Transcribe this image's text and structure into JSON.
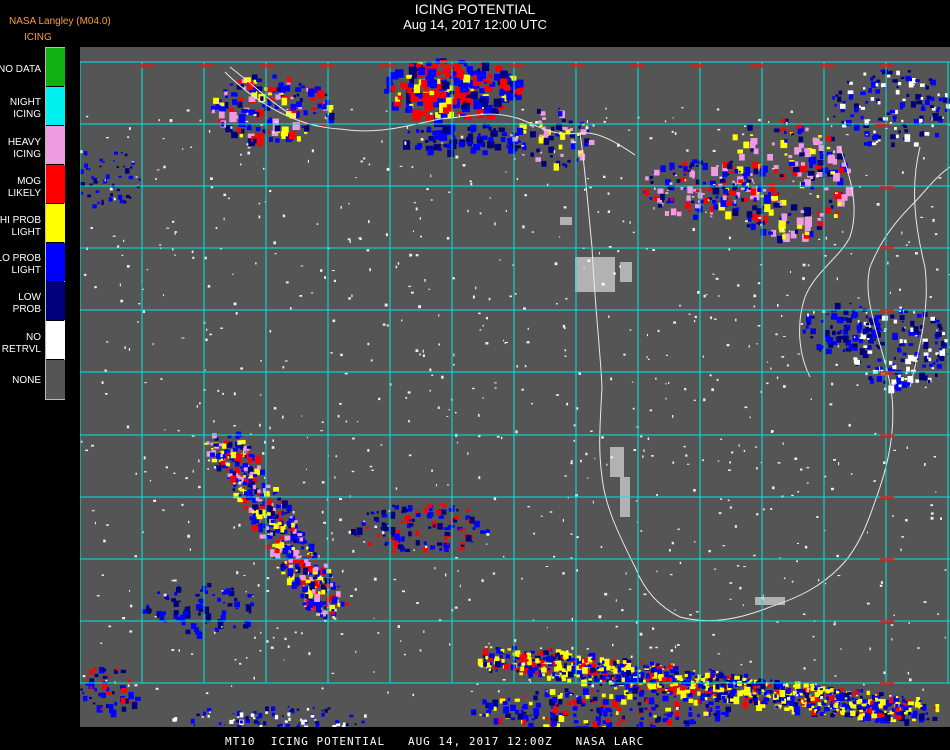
{
  "header": {
    "title": "ICING POTENTIAL",
    "subtitle": "Aug 14, 2017 12:00 UTC",
    "producer": "NASA Langley (M04.0)",
    "product": "ICING"
  },
  "legend": [
    {
      "label": "NO DATA",
      "color": "#10b010"
    },
    {
      "label": "NIGHT\nICING",
      "color": "#00f0f0"
    },
    {
      "label": "HEAVY\nICING",
      "color": "#ee9be0"
    },
    {
      "label": "MOG\nLIKELY",
      "color": "#ff0000"
    },
    {
      "label": "HI PROB\nLIGHT",
      "color": "#ffff00"
    },
    {
      "label": "LO PROB\nLIGHT",
      "color": "#0000ff"
    },
    {
      "label": "LOW\nPROB",
      "color": "#00007a"
    },
    {
      "label": "NO\nRETRVL",
      "color": "#ffffff"
    },
    {
      "label": "NONE",
      "color": "#555555"
    }
  ],
  "map": {
    "background": "#555555",
    "grid_color": "#00e5e5",
    "boundary_color": "#e8e8e8",
    "grid_label_color": "#cc2222"
  },
  "footer": {
    "text": "MT10  ICING POTENTIAL   AUG 14, 2017 12:00Z   NASA LARC"
  }
}
